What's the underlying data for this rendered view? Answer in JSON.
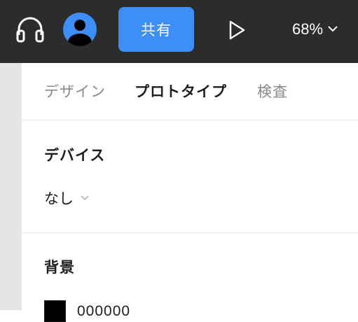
{
  "toolbar": {
    "icons": {
      "headphones": "headphones-icon",
      "avatar": "user-avatar-icon",
      "play": "play-icon",
      "chevron": "chevron-down-icon"
    },
    "share_label": "共有",
    "zoom_value": "68%",
    "colors": {
      "background": "#2c2c2c",
      "accent": "#3d8ef7"
    }
  },
  "panel": {
    "tabs": [
      {
        "label": "デザイン",
        "active": false
      },
      {
        "label": "プロトタイプ",
        "active": true
      },
      {
        "label": "検査",
        "active": false
      }
    ],
    "device": {
      "title": "デバイス",
      "selected": "なし"
    },
    "background": {
      "title": "背景",
      "swatch_color": "#000000",
      "hex": "000000"
    }
  }
}
